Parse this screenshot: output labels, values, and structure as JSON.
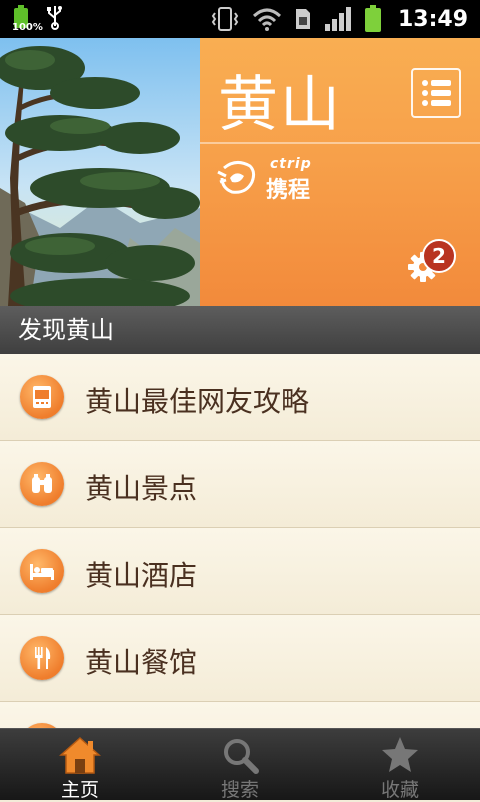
{
  "status_bar": {
    "battery_percent": "100%",
    "time": "13:49"
  },
  "header": {
    "city_name": "黄山",
    "brand_text": "携程",
    "brand_latin": "ctrip",
    "notification_count": "2"
  },
  "section": {
    "title": "发现黄山"
  },
  "list_items": [
    {
      "label": "黄山最佳网友攻略",
      "icon": "guidebook-icon"
    },
    {
      "label": "黄山景点",
      "icon": "binoculars-icon"
    },
    {
      "label": "黄山酒店",
      "icon": "bed-icon"
    },
    {
      "label": "黄山餐馆",
      "icon": "fork-knife-icon"
    }
  ],
  "tabs": [
    {
      "label": "主页",
      "icon": "home-icon",
      "active": true
    },
    {
      "label": "搜索",
      "icon": "search-icon",
      "active": false
    },
    {
      "label": "收藏",
      "icon": "star-icon",
      "active": false
    }
  ],
  "colors": {
    "accent_orange": "#f7a04a",
    "active_tab_icon": "#f08a2c"
  }
}
